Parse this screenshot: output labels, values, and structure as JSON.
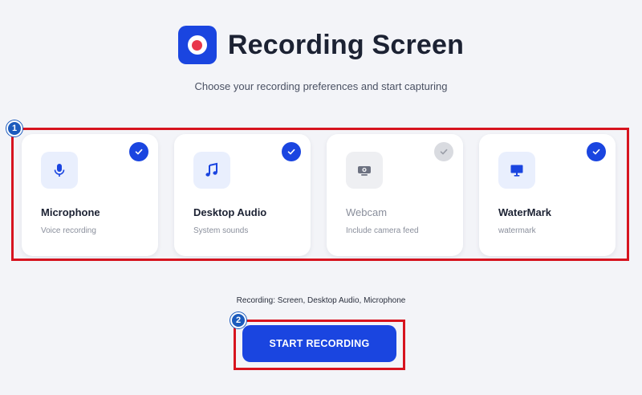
{
  "header": {
    "title": "Recording Screen",
    "subtitle": "Choose your recording preferences and start capturing",
    "logo_icon": "record-icon"
  },
  "annotations": {
    "badge_1": "1",
    "badge_2": "2"
  },
  "options": [
    {
      "title": "Microphone",
      "subtitle": "Voice recording",
      "icon": "microphone-icon",
      "selected": true
    },
    {
      "title": "Desktop Audio",
      "subtitle": "System sounds",
      "icon": "music-note-icon",
      "selected": true
    },
    {
      "title": "Webcam",
      "subtitle": "Include camera feed",
      "icon": "webcam-icon",
      "selected": false
    },
    {
      "title": "WaterMark",
      "subtitle": "watermark",
      "icon": "monitor-icon",
      "selected": true
    }
  ],
  "status_text": "Recording: Screen, Desktop Audio, Microphone",
  "start_button_label": "START RECORDING",
  "colors": {
    "accent": "#1a45e0",
    "record_dot": "#e8364b",
    "highlight_border": "#d7141f",
    "badge": "#1c5bbd",
    "background": "#f3f4f8"
  }
}
